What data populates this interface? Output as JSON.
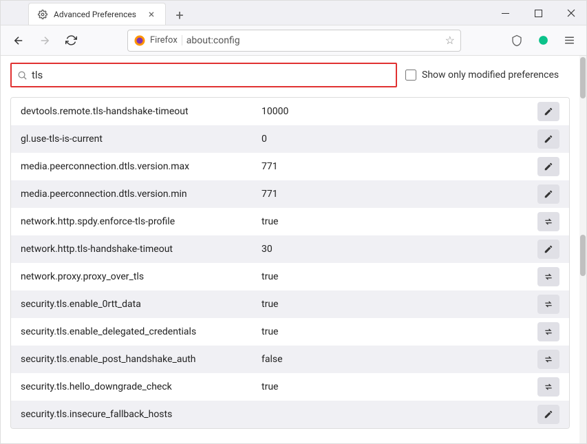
{
  "tab": {
    "title": "Advanced Preferences"
  },
  "urlbar": {
    "identity": "Firefox",
    "url": "about:config"
  },
  "search": {
    "value": "tls",
    "checkbox_label": "Show only modified preferences"
  },
  "prefs": [
    {
      "name": "devtools.remote.tls-handshake-timeout",
      "value": "10000",
      "action": "edit"
    },
    {
      "name": "gl.use-tls-is-current",
      "value": "0",
      "action": "edit"
    },
    {
      "name": "media.peerconnection.dtls.version.max",
      "value": "771",
      "action": "edit"
    },
    {
      "name": "media.peerconnection.dtls.version.min",
      "value": "771",
      "action": "edit"
    },
    {
      "name": "network.http.spdy.enforce-tls-profile",
      "value": "true",
      "action": "toggle"
    },
    {
      "name": "network.http.tls-handshake-timeout",
      "value": "30",
      "action": "edit"
    },
    {
      "name": "network.proxy.proxy_over_tls",
      "value": "true",
      "action": "toggle"
    },
    {
      "name": "security.tls.enable_0rtt_data",
      "value": "true",
      "action": "toggle"
    },
    {
      "name": "security.tls.enable_delegated_credentials",
      "value": "true",
      "action": "toggle"
    },
    {
      "name": "security.tls.enable_post_handshake_auth",
      "value": "false",
      "action": "toggle"
    },
    {
      "name": "security.tls.hello_downgrade_check",
      "value": "true",
      "action": "toggle"
    },
    {
      "name": "security.tls.insecure_fallback_hosts",
      "value": "",
      "action": "edit"
    }
  ]
}
